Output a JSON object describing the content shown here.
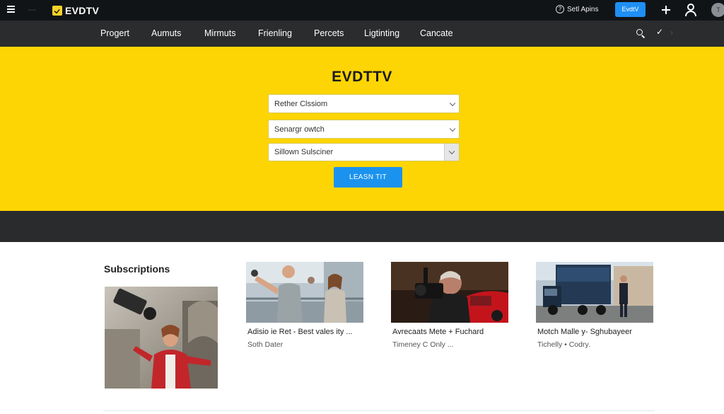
{
  "topbar": {
    "menu_icon": "hamburger-icon",
    "faint_text": "—",
    "logo_text": "EVDTV",
    "help_label": "Setl Apins",
    "help_icon": "help-circle-icon",
    "cta_label": "EvdtV",
    "plus_icon": "plus-icon",
    "user_icon": "user-icon",
    "avatar_text": "T"
  },
  "nav": {
    "items": [
      "Progert",
      "Aumuts",
      "Mirmuts",
      "Frienling",
      "Percets",
      "Ligtinting",
      "Cancate"
    ],
    "search_icon": "search-icon",
    "check_icon": "check-icon",
    "chevron_icon": "chevron-right-icon"
  },
  "hero": {
    "title": "EVDTTV",
    "select1": "Rether Clssiom",
    "select2": "Senargr owtch",
    "select3": "Sillown Sulsciner",
    "button_label": "LEASN TIT"
  },
  "section": {
    "title": "Subscriptions"
  },
  "cards": [
    {
      "title": "Adisio ie Ret - Best vales ity ...",
      "subtitle": "Soth Dater"
    },
    {
      "title": "Avrecaats Mete + Fuchard",
      "subtitle": "Timeney C Only ..."
    },
    {
      "title": "Motch Malle y- Sghubayeer",
      "subtitle": "Tichelly • Codry."
    }
  ],
  "colors": {
    "hero_yellow": "#fed504",
    "accent_blue": "#1b93ee",
    "topbar_bg": "#111417",
    "navbar_bg": "#2a2c2e"
  }
}
